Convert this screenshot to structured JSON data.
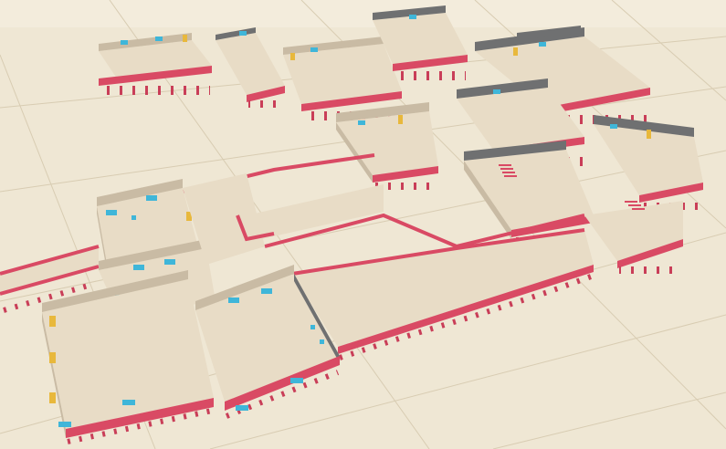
{
  "scene": {
    "name": "isometric-level-editor-viewport",
    "colors": {
      "ground": "#efe7d4",
      "ground_far": "#f3ecdc",
      "grid_line": "#d8ccb2",
      "floor": "#e8dcc6",
      "floor_shade": "#ddd0b8",
      "wall_face": "#c9bba4",
      "wall_dark": "#6f7071",
      "trim": "#d94a64",
      "trim_dark": "#b23650",
      "pillar": "#c93e58",
      "window": "#3fb6d9",
      "door": "#e8b83c",
      "shadow": "#cfc3aa"
    },
    "props": {
      "windows": "window-panel-icon",
      "doors": "yellow-door-icon",
      "stairs": "staircase-icon",
      "chairs": "blue-chair-icon"
    }
  }
}
